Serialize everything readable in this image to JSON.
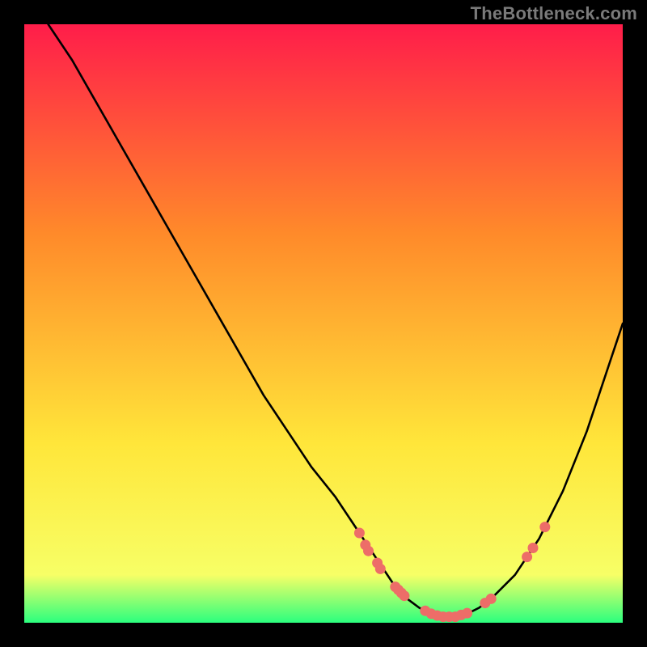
{
  "watermark": "TheBottleneck.com",
  "colors": {
    "background": "#000000",
    "curve": "#000000",
    "dots": "#ed6d68",
    "gradient_top": "#ff1d4a",
    "gradient_mid1": "#ff8a2a",
    "gradient_mid2": "#ffe63a",
    "gradient_bottom1": "#f7ff66",
    "gradient_bottom2": "#2bff7e"
  },
  "chart_data": {
    "type": "line",
    "title": "",
    "xlabel": "",
    "ylabel": "",
    "xlim": [
      0,
      100
    ],
    "ylim": [
      0,
      100
    ],
    "x": [
      4,
      8,
      12,
      16,
      20,
      24,
      28,
      32,
      36,
      40,
      44,
      48,
      52,
      56,
      58,
      60,
      62,
      64,
      66,
      68,
      70,
      72,
      74,
      76,
      78,
      82,
      86,
      90,
      94,
      98,
      100
    ],
    "values": [
      100,
      94,
      87,
      80,
      73,
      66,
      59,
      52,
      45,
      38,
      32,
      26,
      21,
      15,
      12,
      9,
      6,
      4,
      2.5,
      1.5,
      1,
      1,
      1.5,
      2.5,
      4,
      8,
      14,
      22,
      32,
      44,
      50
    ],
    "dots": [
      {
        "x": 56,
        "y": 15
      },
      {
        "x": 57,
        "y": 13
      },
      {
        "x": 57.5,
        "y": 12
      },
      {
        "x": 59,
        "y": 10
      },
      {
        "x": 59.5,
        "y": 9
      },
      {
        "x": 62,
        "y": 6
      },
      {
        "x": 62.5,
        "y": 5.5
      },
      {
        "x": 63,
        "y": 5
      },
      {
        "x": 63.5,
        "y": 4.5
      },
      {
        "x": 67,
        "y": 2
      },
      {
        "x": 68,
        "y": 1.5
      },
      {
        "x": 69,
        "y": 1.2
      },
      {
        "x": 70,
        "y": 1
      },
      {
        "x": 71,
        "y": 1
      },
      {
        "x": 72,
        "y": 1
      },
      {
        "x": 73,
        "y": 1.3
      },
      {
        "x": 74,
        "y": 1.6
      },
      {
        "x": 77,
        "y": 3.3
      },
      {
        "x": 78,
        "y": 4
      },
      {
        "x": 84,
        "y": 11
      },
      {
        "x": 85,
        "y": 12.5
      },
      {
        "x": 87,
        "y": 16
      }
    ]
  }
}
